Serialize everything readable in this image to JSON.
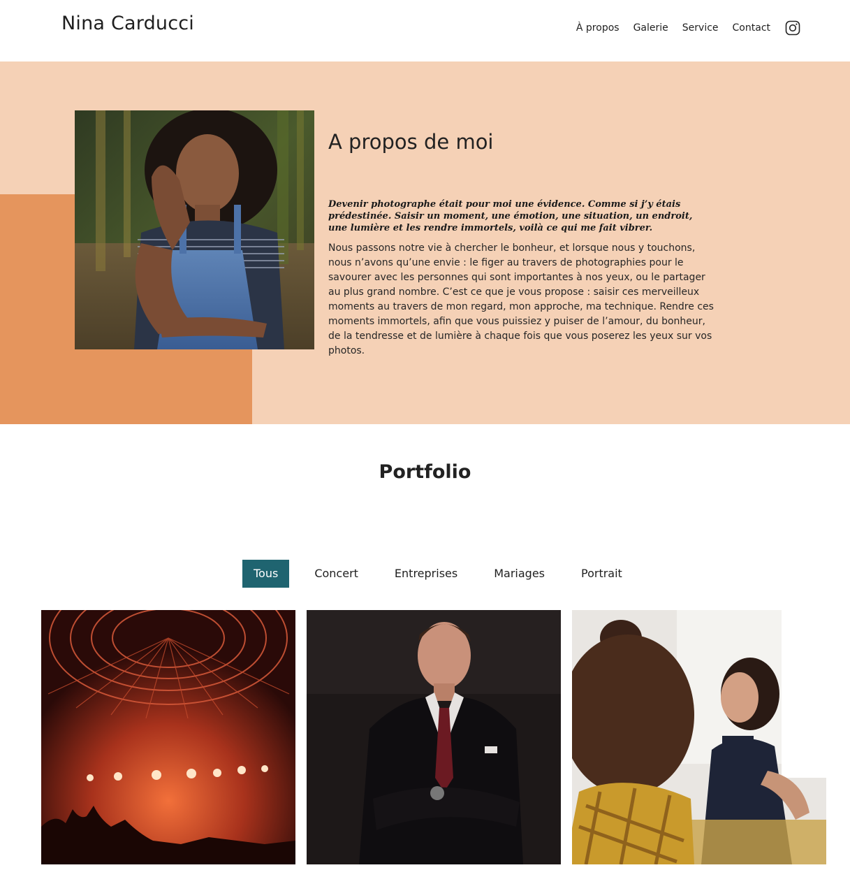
{
  "header": {
    "brand": "Nina Carducci",
    "nav": [
      {
        "label": "À propos"
      },
      {
        "label": "Galerie"
      },
      {
        "label": "Service"
      },
      {
        "label": "Contact"
      }
    ],
    "social_icon": "instagram-icon"
  },
  "about": {
    "title": "A propos de moi",
    "quote": "Devenir photographe était pour moi une évidence. Comme si j’y étais prédestinée. Saisir un moment, une émotion, une situation, un endroit, une lumière et les rendre immortels, voilà ce qui me fait vibrer.",
    "text": "Nous passons notre vie à chercher le bonheur, et lorsque nous y touchons, nous n’avons qu’une envie : le figer au travers de photographies pour le savourer avec les personnes qui sont importantes à nos yeux, ou le partager au plus grand nombre. C’est ce que je vous propose : saisir ces merveilleux moments au travers de mon regard, mon approche, ma technique. Rendre ces moments immortels, afin que vous puissiez y puiser de l’amour, du bonheur, de la tendresse et de lumière à chaque fois que vous poserez les yeux sur vos photos."
  },
  "portfolio": {
    "title": "Portfolio",
    "filters": [
      {
        "label": "Tous",
        "active": true
      },
      {
        "label": "Concert",
        "active": false
      },
      {
        "label": "Entreprises",
        "active": false
      },
      {
        "label": "Mariages",
        "active": false
      },
      {
        "label": "Portrait",
        "active": false
      }
    ]
  },
  "colors": {
    "about_bg": "#f5d1b6",
    "about_accent": "#e5955d",
    "filter_active": "#1f6470"
  }
}
